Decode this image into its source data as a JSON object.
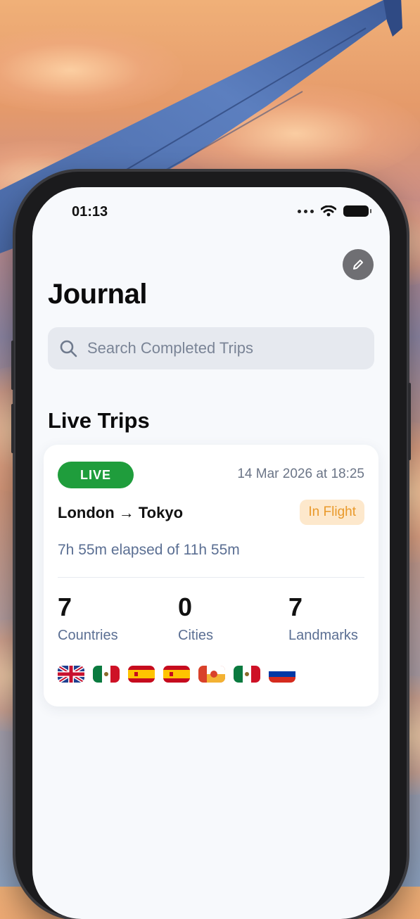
{
  "status_bar": {
    "time": "01:13"
  },
  "header": {
    "title": "Journal"
  },
  "search": {
    "placeholder": "Search Completed Trips"
  },
  "live_section": {
    "title": "Live Trips"
  },
  "trip": {
    "badge": "LIVE",
    "date": "14 Mar 2026 at 18:25",
    "route": "London → Tokyo",
    "status": "In Flight",
    "elapsed": "7h 55m elapsed of 11h 55m",
    "stats": [
      {
        "value": "7",
        "label": "Countries"
      },
      {
        "value": "0",
        "label": "Cities"
      },
      {
        "value": "7",
        "label": "Landmarks"
      }
    ],
    "flags": [
      "gb-flag-icon",
      "mx-flag-icon",
      "es-flag-icon",
      "es-flag-icon",
      "flag-icon",
      "mx-flag-icon",
      "ru-flag-icon"
    ]
  },
  "colors": {
    "live_badge": "#1f9d3c",
    "status_pill_bg": "#fde8cc",
    "status_pill_text": "#e9992a",
    "secondary_text": "#5b6f93"
  }
}
